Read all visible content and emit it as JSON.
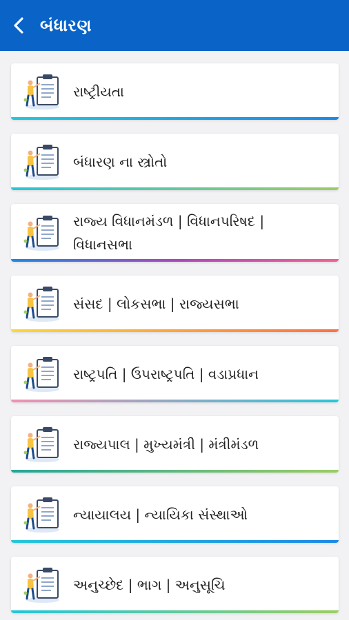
{
  "appbar": {
    "title": "બંધારણ",
    "color": "#0a64c8"
  },
  "items": [
    {
      "label": "રાષ્ટ્રીયતા",
      "bar": "linear-gradient(90deg,#26c6da,#1e88e5)"
    },
    {
      "label": "બંધારણ ના સ્ત્રોતો",
      "bar": "linear-gradient(90deg,#26c6da,#9ccc65)"
    },
    {
      "label": "રાજ્ય વિધાનમંડળ | વિધાનપરિષદ | વિધાનસભા",
      "bar": "linear-gradient(90deg,#1e88e5,#ab47bc,#f06292)"
    },
    {
      "label": "સંસદ | લોકસભા | રાજ્યસભા",
      "bar": "linear-gradient(90deg,#fdd835,#ff7043)"
    },
    {
      "label": "રાષ્ટ્રપતિ | ઉપરાષ્ટ્રપતિ | વડાપ્રધાન",
      "bar": "linear-gradient(90deg,#f48fb1,#26c6da)"
    },
    {
      "label": "રાજ્યપાલ | મુખ્યમંત્રી | મંત્રીમંડળ",
      "bar": "linear-gradient(90deg,#26a69a,#9ccc65)"
    },
    {
      "label": "ન્યાયાલય | ન્યાયિકા સંસ્થાઓ",
      "bar": "linear-gradient(90deg,#26c6da,#1e88e5)"
    },
    {
      "label": "અનુચ્છેદ | ભાગ | અનુસૂચિ",
      "bar": "linear-gradient(90deg,#26c6da,#9ccc65)"
    }
  ]
}
